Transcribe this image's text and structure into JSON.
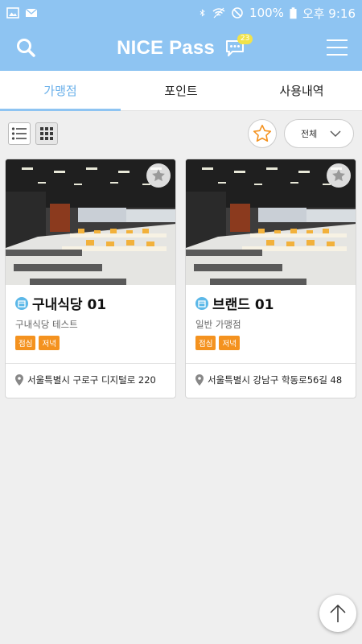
{
  "status_bar": {
    "battery": "100%",
    "time": "오후 9:16",
    "icons": [
      "image-icon",
      "mail-icon",
      "bluetooth-icon",
      "wifi-icon",
      "no-disturb-icon",
      "battery-icon"
    ]
  },
  "header": {
    "title": "NICE Pass",
    "chat_badge": "23",
    "icons": [
      "search-icon",
      "chat-icon",
      "menu-icon"
    ]
  },
  "tabs": [
    {
      "label": "가맹점",
      "active": true
    },
    {
      "label": "포인트",
      "active": false
    },
    {
      "label": "사용내역",
      "active": false
    }
  ],
  "toolbar": {
    "filter_label": "전체",
    "icons": [
      "list-view-icon",
      "grid-view-icon",
      "star-icon",
      "chevron-down-icon"
    ]
  },
  "stores": [
    {
      "name": "구내식당 01",
      "subtitle": "구내식당 테스트",
      "tags": [
        "점심",
        "저녁"
      ],
      "address": "서울특별시 구로구 디지털로 220"
    },
    {
      "name": "브랜드 01",
      "subtitle": "일반 가맹점",
      "tags": [
        "점심",
        "저녁"
      ],
      "address": "서울특별시 강남구 학동로56길 48"
    }
  ],
  "colors": {
    "primary": "#8ec4f2",
    "tab_active": "#6ab0ea",
    "tag": "#f4921f",
    "favorite": "#f4921f"
  }
}
